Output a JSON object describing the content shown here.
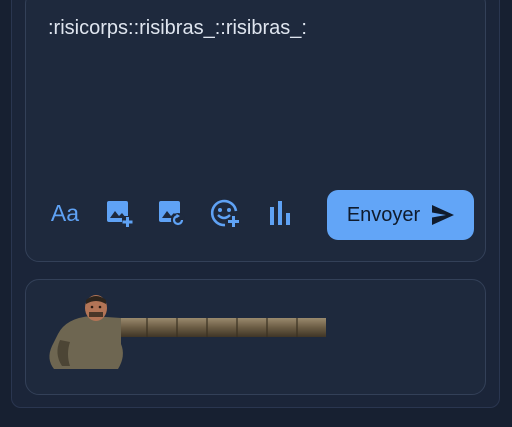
{
  "composer": {
    "text": ":risicorps::risibras_::risibras_:",
    "toolbar": {
      "format_label": "Aa",
      "icons": [
        "format-icon",
        "image-add-icon",
        "image-refresh-icon",
        "emoji-add-icon",
        "poll-chart-icon"
      ]
    },
    "send": {
      "label": "Envoyer",
      "icon": "send-arrow-icon"
    }
  },
  "preview": {
    "items": [
      {
        "icon": "risicorps-sticker"
      },
      {
        "icon": "risibras-sticker"
      },
      {
        "icon": "risibras-sticker"
      }
    ]
  },
  "colors": {
    "background": "#172031",
    "panel": "#1e293d",
    "border": "#334058",
    "accent": "#62a5f7",
    "icon": "#5fa2f5",
    "text": "#dfe5ef"
  }
}
